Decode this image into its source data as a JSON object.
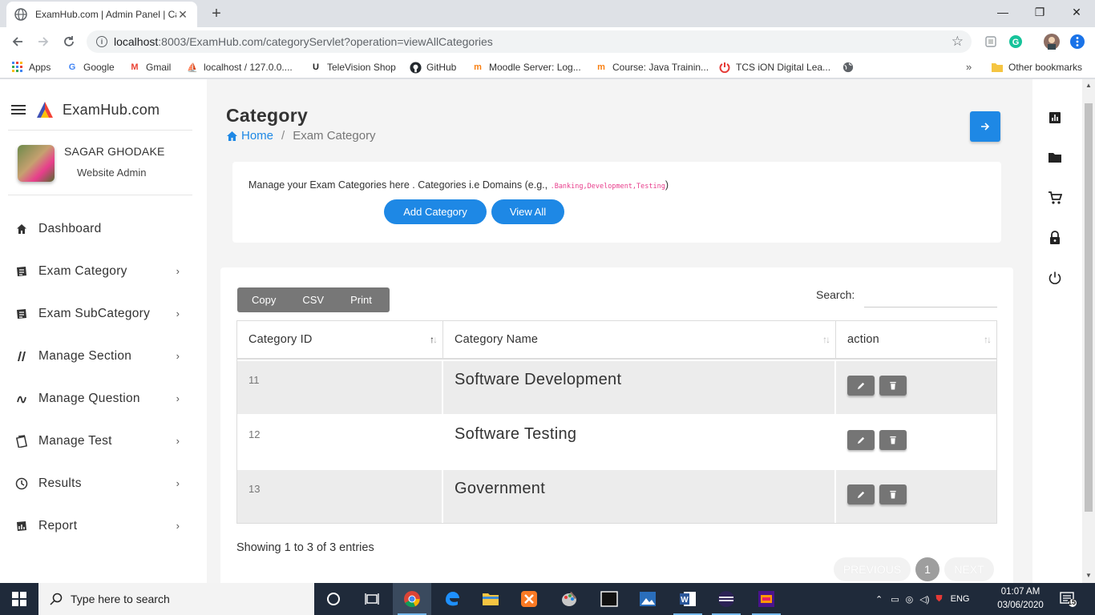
{
  "browser": {
    "tab_title": "ExamHub.com | Admin Panel | Ca",
    "url_host": "localhost",
    "url_path": ":8003/ExamHub.com/categoryServlet?operation=viewAllCategories",
    "bookmarks": [
      "Apps",
      "Google",
      "Gmail",
      "localhost / 127.0.0....",
      "TeleVision Shop",
      "GitHub",
      "Moodle Server: Log...",
      "Course: Java Trainin...",
      "TCS iON Digital Lea..."
    ],
    "other_bookmarks": "Other bookmarks"
  },
  "sidebar": {
    "brand": "ExamHub.com",
    "user_name": "SAGAR GHODAKE",
    "user_role": "Website Admin",
    "items": [
      {
        "label": "Dashboard",
        "icon": "home-icon"
      },
      {
        "label": "Exam Category",
        "icon": "category-icon"
      },
      {
        "label": "Exam SubCategory",
        "icon": "subcategory-icon"
      },
      {
        "label": "Manage Section",
        "icon": "section-icon"
      },
      {
        "label": "Manage Question",
        "icon": "question-icon"
      },
      {
        "label": "Manage Test",
        "icon": "test-icon"
      },
      {
        "label": "Results",
        "icon": "clock-icon"
      },
      {
        "label": "Report",
        "icon": "report-icon"
      }
    ]
  },
  "header": {
    "title": "Category",
    "breadcrumb_home": "Home",
    "breadcrumb_current": "Exam Category",
    "divider": "/"
  },
  "intro": {
    "text": "Manage your Exam Categories here . Categories i.e Domains (e.g., ",
    "code": ".Banking,Development,Testing",
    "text_end": ")",
    "add_label": "Add Category",
    "view_label": "View All"
  },
  "table": {
    "buttons": [
      "Copy",
      "CSV",
      "Print"
    ],
    "search_label": "Search:",
    "columns": [
      "Category ID",
      "Category Name",
      "action"
    ],
    "rows": [
      {
        "id": "11",
        "name": "Software Development"
      },
      {
        "id": "12",
        "name": "Software Testing"
      },
      {
        "id": "13",
        "name": "Government"
      }
    ],
    "info": "Showing 1 to 3 of 3 entries",
    "prev_label": "PREVIOUS",
    "page": "1",
    "next_label": "NEXT"
  },
  "taskbar": {
    "search_placeholder": "Type here to search",
    "lang": "ENG",
    "time": "01:07 AM",
    "date": "03/06/2020",
    "notifications": "15"
  },
  "colors": {
    "accent": "#1e88e5",
    "button_grey": "#757575",
    "code_pink": "#e83e8c"
  }
}
